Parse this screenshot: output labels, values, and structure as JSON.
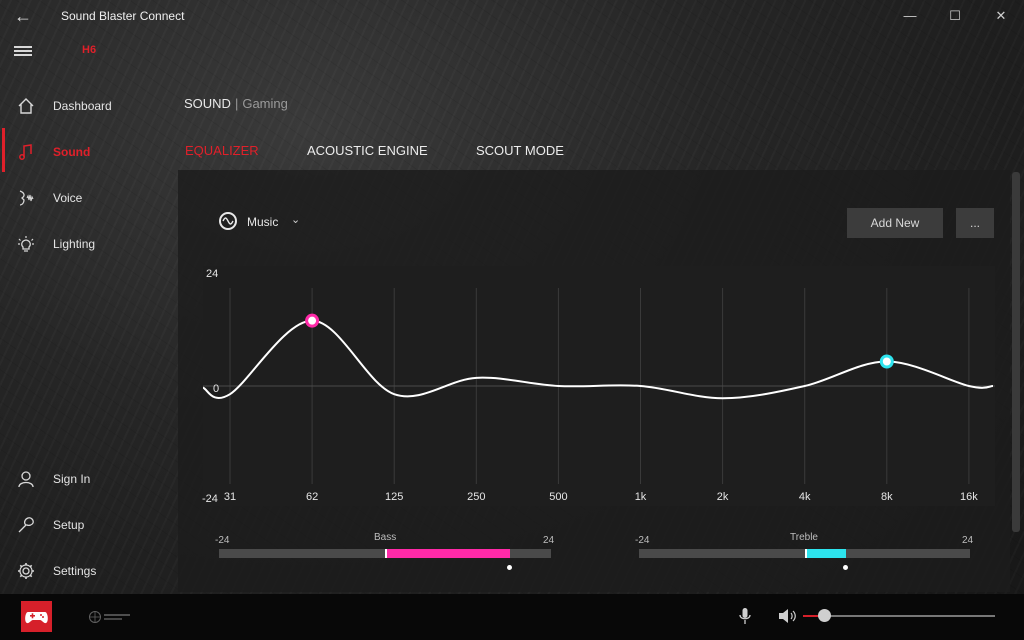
{
  "app": {
    "title": "Sound Blaster Connect",
    "device": "H6"
  },
  "sidebar": {
    "top_items": [
      {
        "label": "Dashboard",
        "icon": "home-icon"
      },
      {
        "label": "Sound",
        "icon": "music-note-icon",
        "active": true
      },
      {
        "label": "Voice",
        "icon": "voice-icon"
      },
      {
        "label": "Lighting",
        "icon": "lightbulb-icon"
      }
    ],
    "bottom_items": [
      {
        "label": "Sign In",
        "icon": "user-icon"
      },
      {
        "label": "Setup",
        "icon": "wrench-icon"
      },
      {
        "label": "Settings",
        "icon": "gear-icon"
      }
    ]
  },
  "header": {
    "section": "SOUND",
    "separator": "|",
    "profile": "Gaming"
  },
  "tabs": [
    {
      "label": "EQUALIZER",
      "active": true
    },
    {
      "label": "ACOUSTIC ENGINE",
      "active": false
    },
    {
      "label": "SCOUT MODE",
      "active": false
    }
  ],
  "preset": {
    "label": "Music",
    "icon": "waveform-icon"
  },
  "buttons": {
    "add_new": "Add New",
    "more": "..."
  },
  "equalizer": {
    "y_max_label": "24",
    "y_zero_label": "0",
    "y_min_label": "-24",
    "y_range": [
      -24,
      24
    ],
    "frequencies": [
      "31",
      "62",
      "125",
      "250",
      "500",
      "1k",
      "2k",
      "4k",
      "8k",
      "16k"
    ],
    "gains": [
      -2,
      16,
      -2,
      2,
      0,
      0,
      -3,
      0,
      6,
      0
    ],
    "highlight_bass_band": "62",
    "highlight_treble_band": "8k",
    "bass_color": "#ff2aa8",
    "treble_color": "#2de4ee"
  },
  "bass": {
    "title": "Bass",
    "min": "-24",
    "max": "24",
    "range": [
      -24,
      24
    ],
    "value": 18,
    "color": "#ff2aa8"
  },
  "treble": {
    "title": "Treble",
    "min": "-24",
    "max": "24",
    "range": [
      -24,
      24
    ],
    "value": 6,
    "color": "#2de4ee"
  },
  "bottom_bar": {
    "scout_logo_text": "SCOUT MODE",
    "volume_fraction": 0.11,
    "accent": "#d6202a"
  },
  "colors": {
    "accent": "#e0202a",
    "panel": "#1e1e1e"
  }
}
